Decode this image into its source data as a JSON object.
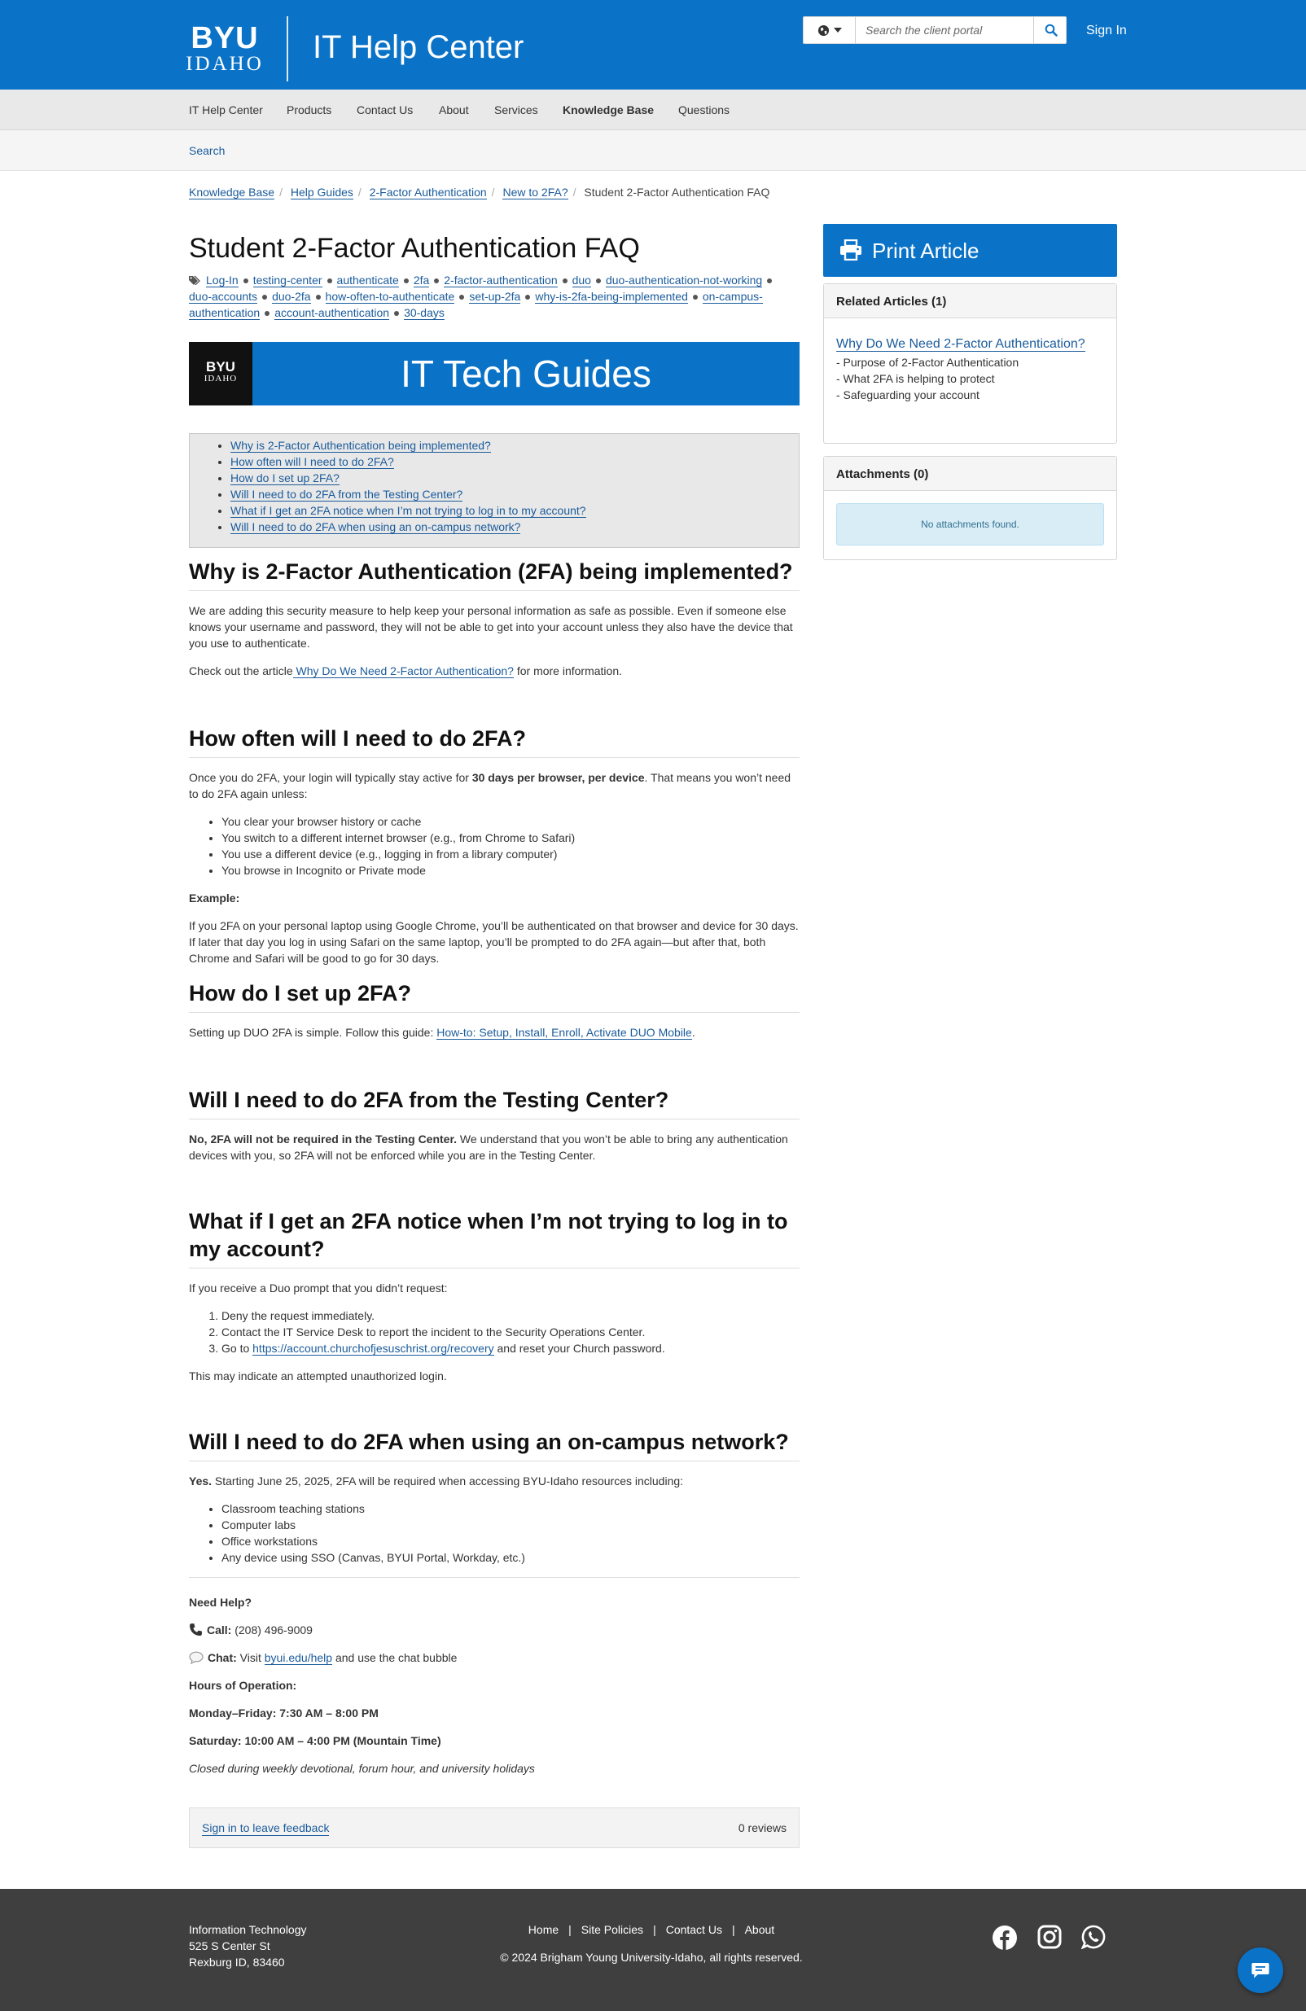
{
  "header": {
    "logo_line1": "BYU",
    "logo_line2": "IDAHO",
    "site_title": "IT Help Center",
    "search_placeholder": "Search the client portal",
    "sign_in": "Sign In",
    "brand_color": "#0a73c8"
  },
  "nav": {
    "items": [
      "IT Help Center",
      "Products",
      "Contact Us",
      "About",
      "Services",
      "Knowledge Base",
      "Questions"
    ],
    "active": "Knowledge Base",
    "sub_items": [
      "Search"
    ]
  },
  "breadcrumb": [
    "Knowledge Base",
    "Help Guides",
    "2-Factor Authentication",
    "New to 2FA?",
    "Student 2-Factor Authentication FAQ"
  ],
  "article": {
    "title": "Student 2-Factor Authentication FAQ",
    "tags": [
      "Log-In",
      "testing-center",
      "authenticate",
      "2fa",
      "2-factor-authentication",
      "duo",
      "duo-authentication-not-working",
      "duo-accounts",
      "duo-2fa",
      "how-often-to-authenticate",
      "set-up-2fa",
      "why-is-2fa-being-implemented",
      "on-campus-authentication",
      "account-authentication",
      "30-days"
    ],
    "banner": {
      "logo_line1": "BYU",
      "logo_line2": "IDAHO",
      "text": "IT Tech Guides"
    },
    "toc": [
      "Why is 2-Factor Authentication being implemented?",
      "How often will I need to do 2FA?",
      "How do I set up 2FA?",
      "Will I need to do 2FA from the Testing Center?",
      "What if I get an 2FA notice when I’m not trying to log in to my account?",
      "Will I need to do 2FA when using an on-campus network?"
    ],
    "s1": {
      "heading": "Why is 2-Factor Authentication (2FA) being implemented?",
      "p1": "We are adding this security measure to help keep your personal information as safe as possible. Even if someone else knows your username and password, they will not be able to get into your account unless they also have the device that you use to authenticate.",
      "p2_pre": "Check out the article",
      "p2_link": " Why Do We Need 2-Factor Authentication?",
      "p2_post": " for more information."
    },
    "s2": {
      "heading": "How often will I need to do 2FA?",
      "p1_pre": "Once you do 2FA, your login will typically stay active for ",
      "p1_bold": "30 days per browser, per device",
      "p1_post": ". That means you won’t need to do 2FA again unless:",
      "bullets": [
        "You clear your browser history or cache",
        "You switch to a different internet browser (e.g., from Chrome to Safari)",
        "You use a different device (e.g., logging in from a library computer)",
        "You browse in Incognito or Private mode"
      ],
      "example_label": "Example:",
      "example": "If you 2FA on your personal laptop using Google Chrome, you’ll be authenticated on that browser and device for 30 days. If later that day you log in using Safari on the same laptop, you’ll be prompted to do 2FA again—but after that, both Chrome and Safari will be good to go for 30 days."
    },
    "s3": {
      "heading": "How do I set up 2FA?",
      "p_pre": "Setting up DUO 2FA is simple. Follow this guide: ",
      "p_link": "How-to: Setup, Install, Enroll, Activate DUO Mobile",
      "p_post": "."
    },
    "s4": {
      "heading": "Will I need to do 2FA from the Testing Center?",
      "p_bold": "No, 2FA will not be required in the Testing Center.",
      "p_rest": " We understand that you won’t be able to bring any authentication devices with you, so 2FA will not be enforced while you are in the Testing Center."
    },
    "s5": {
      "heading": "What if I get an 2FA notice when I’m not trying to log in to my account?",
      "intro": "If you receive a Duo prompt that you didn’t request:",
      "step1": "Deny the request immediately.",
      "step2": "Contact the IT Service Desk to report the incident to the Security Operations Center.",
      "step3_pre": "Go to ",
      "step3_link": "https://account.churchofjesuschrist.org/recovery",
      "step3_post": " and reset your Church password.",
      "outro": "This may indicate an attempted unauthorized login."
    },
    "s6": {
      "heading": "Will I need to do 2FA when using an on-campus network?",
      "p_bold": "Yes.",
      "p_rest": " Starting June 25, 2025, 2FA will be required when accessing BYU-Idaho resources including:",
      "bullets": [
        "Classroom teaching stations",
        "Computer labs",
        "Office workstations",
        "Any device using SSO (Canvas, BYUI Portal, Workday, etc.)"
      ]
    },
    "help": {
      "heading": "Need Help?",
      "call_label": "Call:",
      "call_value": " (208) 496-9009",
      "chat_label": "Chat:",
      "chat_pre": " Visit ",
      "chat_link": "byui.edu/help",
      "chat_post": " and use the chat bubble",
      "hours_label": "Hours of Operation:",
      "weekday": "Monday–Friday: 7:30 AM – 8:00 PM",
      "saturday": "Saturday: 10:00 AM – 4:00 PM (Mountain Time)",
      "closed": "Closed during weekly devotional, forum hour, and university holidays"
    },
    "feedback": {
      "link": "Sign in to leave feedback",
      "reviews": "0 reviews"
    }
  },
  "sidebar": {
    "print": "Print Article",
    "related_heading": "Related Articles (1)",
    "related_link": "Why Do We Need 2-Factor Authentication?",
    "related_points": [
      "- Purpose of 2-Factor Authentication",
      "- What 2FA is helping to protect",
      "- Safeguarding your account"
    ],
    "attachments_heading": "Attachments (0)",
    "attachments_empty": "No attachments found."
  },
  "footer": {
    "org": "Information Technology",
    "street": "525 S Center St",
    "city": "Rexburg ID, 83460",
    "links": [
      "Home",
      "Site Policies",
      "Contact Us",
      "About"
    ],
    "copyright": "© 2024 Brigham Young University-Idaho, all rights reserved.",
    "social_icons": [
      "facebook-icon",
      "instagram-icon",
      "whatsapp-icon"
    ],
    "bg_color": "#3f3f3f"
  }
}
